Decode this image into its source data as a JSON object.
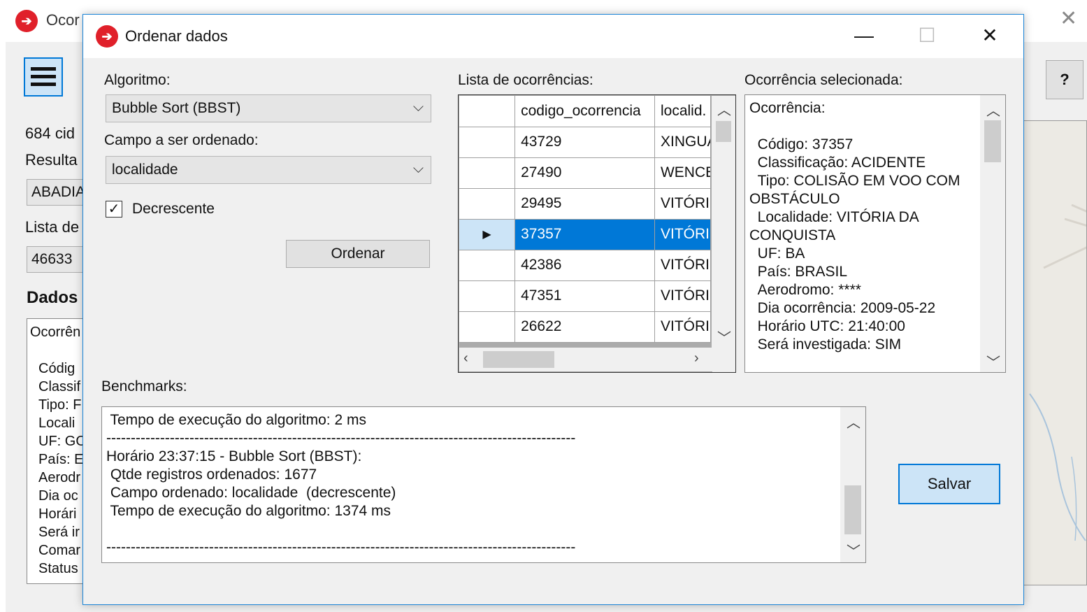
{
  "background_window": {
    "title": "Ocor",
    "close_glyph": "✕",
    "help_label": "?",
    "labels": {
      "cidades": "684 cid",
      "resultado": "Resulta",
      "lista": "Lista de",
      "dados": "Dados"
    },
    "fields": {
      "resultado_value": "ABADIA",
      "lista_value": "46633"
    },
    "details_lines": [
      "Ocorrên",
      "",
      "Códig",
      "Classif",
      "Tipo: F",
      "Locali",
      "UF: GO",
      "País: E",
      "Aerodr",
      "Dia oc",
      "Horári",
      "Será ir",
      "Comar",
      "Status"
    ]
  },
  "dialog": {
    "title": "Ordenar dados",
    "controls": {
      "minimize": "—",
      "maximize": "☐",
      "close": "✕"
    },
    "algoritmo": {
      "label": "Algoritmo:",
      "selected": "Bubble Sort (BBST)"
    },
    "campo": {
      "label": "Campo a ser ordenado:",
      "selected": "localidade"
    },
    "decrescente": {
      "label": "Decrescente",
      "checked": true,
      "check_glyph": "✓"
    },
    "ordenar_label": "Ordenar",
    "lista_label": "Lista de ocorrências:",
    "grid": {
      "columns": [
        "codigo_ocorrencia",
        "localid."
      ],
      "rows": [
        {
          "codigo": "43729",
          "localidade": "XINGUA"
        },
        {
          "codigo": "27490",
          "localidade": "WENCE"
        },
        {
          "codigo": "29495",
          "localidade": "VITÓRI"
        },
        {
          "codigo": "37357",
          "localidade": "VITÓRI",
          "selected": true
        },
        {
          "codigo": "42386",
          "localidade": "VITÓRI"
        },
        {
          "codigo": "47351",
          "localidade": "VITÓRI"
        },
        {
          "codigo": "26622",
          "localidade": "VITÓRI"
        }
      ],
      "row_pointer_glyph": "▶"
    },
    "selecionada_label": "Ocorrência selecionada:",
    "selecionada_text": "Ocorrência:\n\n  Código: 37357\n  Classificação: ACIDENTE\n  Tipo: COLISÃO EM VOO COM\nOBSTÁCULO\n  Localidade: VITÓRIA DA\nCONQUISTA\n  UF: BA\n  País: BRASIL\n  Aerodromo: ****\n  Dia ocorrência: 2009-05-22\n  Horário UTC: 21:40:00\n  Será investigada: SIM",
    "benchmarks_label": "Benchmarks:",
    "benchmarks_text": " Tempo de execução do algoritmo: 2 ms\n------------------------------------------------------------------------------------------------\nHorário 23:37:15 - Bubble Sort (BBST):\n Qtde registros ordenados: 1677\n Campo ordenado: localidade  (decrescente)\n Tempo de execução do algoritmo: 1374 ms\n\n------------------------------------------------------------------------------------------------",
    "salvar_label": "Salvar"
  },
  "icons": {
    "app_logo": "plane-logo-icon",
    "dropdown": "chevron-down-icon",
    "scroll_up": "chevron-up-icon",
    "scroll_down": "chevron-down-icon",
    "scroll_left": "chevron-left-icon",
    "scroll_right": "chevron-right-icon",
    "menu": "hamburger-menu-icon"
  },
  "colors": {
    "accent": "#0078d7",
    "selection": "#0078d7",
    "button_focus_bg": "#cce4f7",
    "logo_red": "#e0202a"
  }
}
